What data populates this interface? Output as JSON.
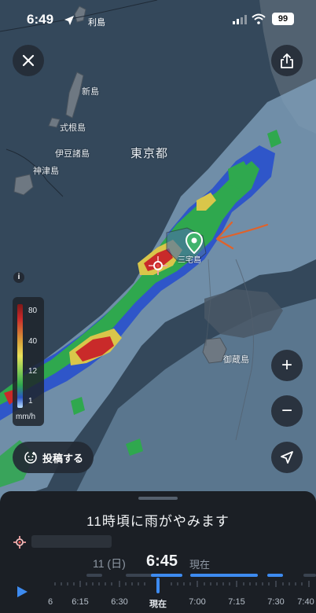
{
  "status_bar": {
    "time": "6:49",
    "location_label": "利島",
    "battery": "99"
  },
  "map": {
    "labels": {
      "toshima": "利島",
      "niijima": "新島",
      "shikinejima": "式根島",
      "izu_islands": "伊豆諸島",
      "kozushima": "神津島",
      "tokyo": "東京都",
      "miyakejima": "三宅島",
      "mikurajima": "御蔵島"
    }
  },
  "buttons": {
    "close_icon": "close-icon",
    "share_icon": "share-icon",
    "info_icon": "info-icon",
    "zoom_in": "+",
    "zoom_out": "−",
    "post_label": "投稿する"
  },
  "legend": {
    "ticks": [
      "80",
      "40",
      "12",
      "1"
    ],
    "unit": "mm/h"
  },
  "sheet": {
    "headline": "11時頃に雨がやみます",
    "date": "11 (日)",
    "current_time": "6:45",
    "current_label": "現在",
    "timeline_labels": [
      "6",
      "6:15",
      "6:30",
      "現在",
      "7:00",
      "7:15",
      "7:30",
      "7:40"
    ]
  },
  "colors": {
    "map_sea": "#34485b",
    "rain_light": "#7aa6c6",
    "rain_blue": "#2f56c9",
    "rain_green": "#2fa84e",
    "rain_yellow": "#d9c64a",
    "rain_red": "#c92a2a",
    "accent": "#3d8bf0",
    "annotation_orange": "#e0622a"
  }
}
